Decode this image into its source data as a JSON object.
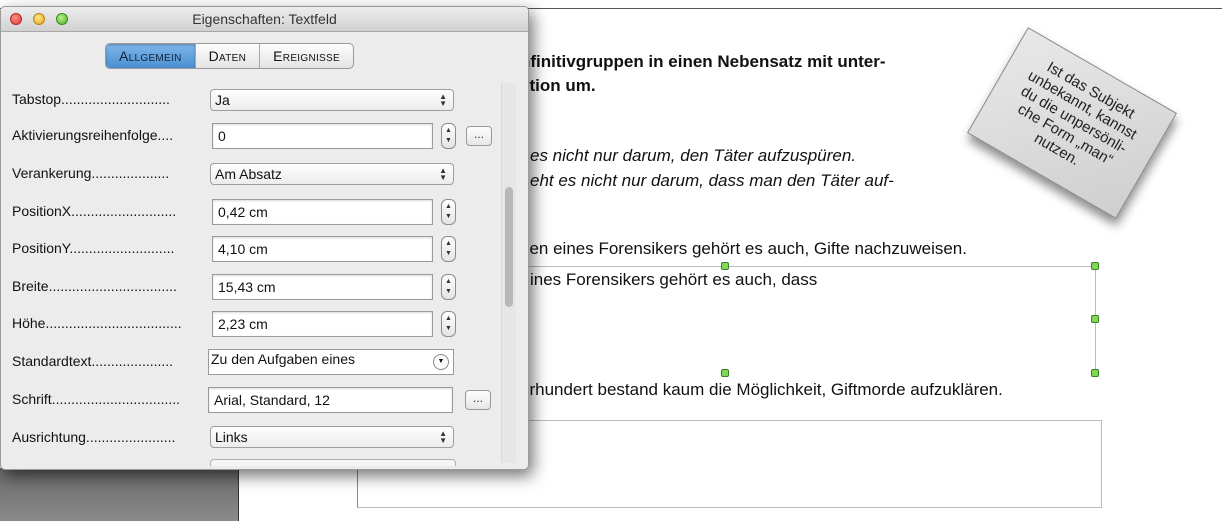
{
  "window": {
    "title": "Eigenschaften: Textfeld",
    "tabs": [
      {
        "label": "Allgemein",
        "active": true
      },
      {
        "label": "Daten",
        "active": false
      },
      {
        "label": "Ereignisse",
        "active": false
      }
    ]
  },
  "form": {
    "tabstop": {
      "label": "Tabstop............................",
      "value": "Ja"
    },
    "activation_order": {
      "label": "Aktivierungsreihenfolge....",
      "value": "0",
      "button": "..."
    },
    "anchoring": {
      "label": "Verankerung....................",
      "value": "Am Absatz"
    },
    "position_x": {
      "label": "PositionX...........................",
      "value": "0,42 cm"
    },
    "position_y": {
      "label": "PositionY...........................",
      "value": "4,10 cm"
    },
    "width": {
      "label": "Breite.................................",
      "value": "15,43 cm"
    },
    "height": {
      "label": "Höhe...................................",
      "value": "2,23 cm"
    },
    "default_text": {
      "label": "Standardtext.....................",
      "value": "Zu den Aufgaben eines"
    },
    "font": {
      "label": "Schrift.................................",
      "value": "Arial, Standard, 12",
      "button": "..."
    },
    "alignment": {
      "label": "Ausrichtung.......................",
      "value": "Links"
    }
  },
  "document": {
    "heading_line1": "nfinitivgruppen in einen Nebensatz mit unter-",
    "heading_line2": "ktion um.",
    "italic_line1": "es nicht nur darum, den Täter aufzuspüren.",
    "italic_line2": "eht es nicht nur darum, dass man den Täter auf-",
    "line_tasks": "ben eines Forensikers gehört es auch, Gifte nachzuweisen.",
    "textbox_text": "ines Forensikers gehört es auch, dass",
    "line_century": "hrhundert bestand kaum die Möglichkeit, Giftmorde aufzuklären.",
    "sticky_note": "Ist das Subjekt\nunbekannt, kannst\ndu die unpersönli-\nche Form „man“\nnutzen."
  },
  "icons": {
    "close": "close-icon",
    "minimize": "minimize-icon",
    "zoom": "zoom-icon",
    "select_arrows": "up-down-arrows-icon",
    "stepper": "stepper-icon"
  },
  "colors": {
    "active_tab": "#5b9ddb",
    "handle": "#7ed957",
    "close": "#e0443a",
    "minimize": "#e5a41d",
    "zoom": "#56b12f"
  }
}
